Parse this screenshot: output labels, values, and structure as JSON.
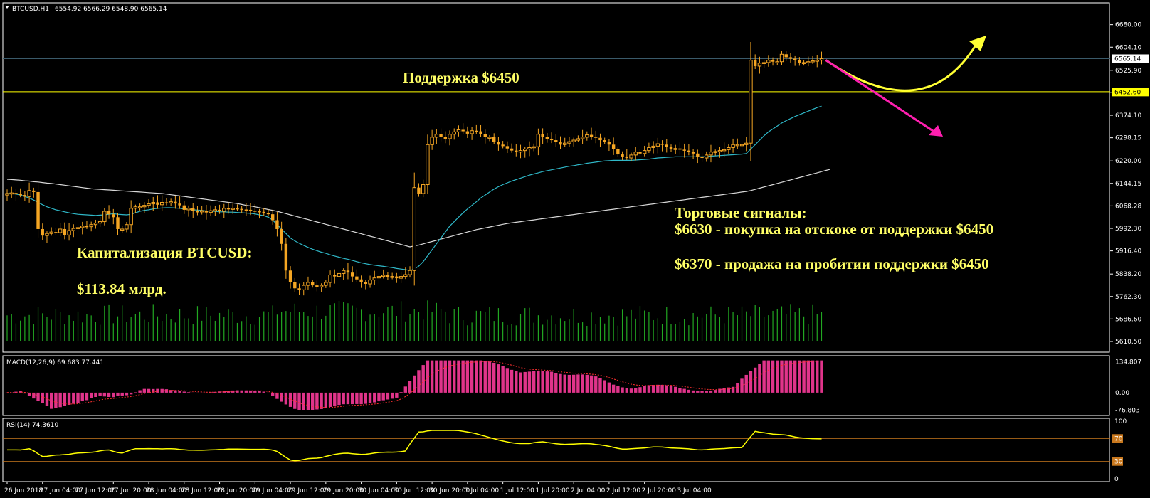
{
  "header": {
    "symbol": "BTCUSD,H1",
    "ohlc": "6554.92 6566.29 6548.90 6565.14",
    "macd_label": "MACD(12,26,9) 69.683 77.441",
    "rsi_label": "RSI(14) 74.3610"
  },
  "annotations": {
    "support": "Поддержка $6450",
    "cap_title": "Капитализация BTCUSD:",
    "cap_value": "$113.84 млрд.",
    "signals_title": "Торговые сигналы:",
    "signal_buy": "$6630 - покупка на отскоке от поддержки $6450",
    "signal_sell": "$6370 - продажа на пробитии поддержки $6450"
  },
  "colors": {
    "background": "#000000",
    "candle": "#f5a623",
    "support_line": "#ffff00",
    "ma_fast": "#2fb8c8",
    "ma_slow": "#d8d8d8",
    "volume": "#22a822",
    "macd_hist": "#e0348a",
    "macd_signal": "#ff3030",
    "rsi_line": "#ffff00",
    "rsi_levels": "#c8781e",
    "arrow_up": "#ffff33",
    "arrow_down": "#ff1fb0",
    "current_price_line": "#3a5a6a"
  },
  "chart_data": {
    "type": "candlestick",
    "instrument": "BTCUSD",
    "timeframe": "H1",
    "price_axis": {
      "ylim": [
        5610.5,
        6720
      ],
      "ticks": [
        "6680.00",
        "6604.10",
        "6525.90",
        "6451.55",
        "6374.10",
        "6298.15",
        "6220.00",
        "6144.15",
        "6068.28",
        "5992.30",
        "5916.40",
        "5838.20",
        "5762.30",
        "5686.60",
        "5610.50"
      ],
      "current_price": 6565.14,
      "current_price_tag": "6565.14",
      "support_level": 6452.6,
      "support_tag": "6452.60"
    },
    "x_axis": {
      "ticks": [
        "26 Jun 2018",
        "27 Jun 04:00",
        "27 Jun 12:00",
        "27 Jun 20:00",
        "28 Jun 04:00",
        "28 Jun 12:00",
        "28 Jun 20:00",
        "29 Jun 04:00",
        "29 Jun 12:00",
        "29 Jun 20:00",
        "30 Jun 04:00",
        "30 Jun 12:00",
        "30 Jun 20:00",
        "1 Jul 04:00",
        "1 Jul 12:00",
        "1 Jul 20:00",
        "2 Jul 04:00",
        "2 Jul 12:00",
        "2 Jul 20:00",
        "3 Jul 04:00"
      ],
      "bars_per_tick": 8
    },
    "candles_close": [
      6110,
      6112,
      6108,
      6105,
      6100,
      6120,
      6115,
      5990,
      5968,
      5975,
      5980,
      5978,
      5990,
      5970,
      5985,
      5992,
      5995,
      6000,
      5998,
      6005,
      6010,
      6015,
      6050,
      6040,
      6030,
      5990,
      5990,
      6005,
      6060,
      6065,
      6065,
      6070,
      6075,
      6080,
      6072,
      6080,
      6078,
      6082,
      6076,
      6070,
      6055,
      6060,
      6050,
      6048,
      6052,
      6046,
      6052,
      6055,
      6050,
      6060,
      6058,
      6060,
      6058,
      6056,
      6055,
      6052,
      6050,
      6048,
      6045,
      6040,
      6020,
      5990,
      5940,
      5850,
      5810,
      5790,
      5785,
      5800,
      5810,
      5800,
      5795,
      5800,
      5810,
      5835,
      5830,
      5840,
      5850,
      5843,
      5830,
      5820,
      5810,
      5805,
      5818,
      5825,
      5830,
      5834,
      5828,
      5830,
      5824,
      5830,
      5836,
      5850,
      6130,
      6110,
      6140,
      6275,
      6300,
      6310,
      6300,
      6295,
      6310,
      6318,
      6325,
      6320,
      6312,
      6322,
      6320,
      6310,
      6300,
      6300,
      6285,
      6275,
      6270,
      6262,
      6255,
      6250,
      6255,
      6260,
      6265,
      6268,
      6310,
      6300,
      6295,
      6290,
      6285,
      6275,
      6280,
      6285,
      6290,
      6295,
      6300,
      6308,
      6302,
      6298,
      6290,
      6285,
      6275,
      6260,
      6242,
      6235,
      6230,
      6240,
      6250,
      6245,
      6255,
      6265,
      6270,
      6278,
      6275,
      6268,
      6260,
      6262,
      6258,
      6255,
      6250,
      6245,
      6235,
      6230,
      6240,
      6250,
      6252,
      6255,
      6258,
      6265,
      6275,
      6275,
      6275,
      6280,
      6560,
      6540,
      6550,
      6552,
      6560,
      6555,
      6555,
      6580,
      6570,
      6565,
      6560,
      6550,
      6552,
      6555,
      6558,
      6560,
      6565
    ],
    "ma_fast": [
      6110,
      6110,
      6108,
      6105,
      6100,
      6095,
      6088,
      6080,
      6072,
      6065,
      6060,
      6055,
      6052,
      6048,
      6045,
      6042,
      6040,
      6039,
      6038,
      6037,
      6036,
      6037,
      6038,
      6040,
      6042,
      6040,
      6039,
      6038,
      6040,
      6045,
      6050,
      6053,
      6055,
      6058,
      6060,
      6061,
      6062,
      6062,
      6061,
      6060,
      6058,
      6057,
      6055,
      6054,
      6053,
      6051,
      6050,
      6050,
      6048,
      6048,
      6047,
      6047,
      6046,
      6045,
      6044,
      6043,
      6041,
      6038,
      6035,
      6030,
      6020,
      6005,
      5990,
      5975,
      5960,
      5950,
      5942,
      5935,
      5928,
      5922,
      5917,
      5912,
      5908,
      5903,
      5899,
      5895,
      5891,
      5888,
      5884,
      5880,
      5876,
      5873,
      5870,
      5868,
      5866,
      5864,
      5862,
      5860,
      5857,
      5855,
      5853,
      5850,
      5855,
      5865,
      5880,
      5900,
      5920,
      5940,
      5960,
      5980,
      6000,
      6015,
      6030,
      6045,
      6058,
      6070,
      6082,
      6095,
      6105,
      6115,
      6125,
      6133,
      6140,
      6146,
      6152,
      6157,
      6162,
      6167,
      6172,
      6176,
      6180,
      6184,
      6187,
      6190,
      6193,
      6196,
      6199,
      6202,
      6204,
      6207,
      6209,
      6212,
      6214,
      6216,
      6218,
      6220,
      6221,
      6222,
      6222,
      6222,
      6222,
      6222,
      6223,
      6224,
      6225,
      6226,
      6228,
      6230,
      6231,
      6232,
      6233,
      6234,
      6234,
      6234,
      6234,
      6234,
      6234,
      6234,
      6235,
      6236,
      6237,
      6238,
      6239,
      6240,
      6241,
      6242,
      6243,
      6245,
      6260,
      6275,
      6290,
      6305,
      6318,
      6328,
      6338,
      6348,
      6356,
      6363,
      6370,
      6376,
      6382,
      6388,
      6394,
      6400,
      6405
    ],
    "ma_slow": [
      6158,
      6157,
      6156,
      6155,
      6153,
      6152,
      6150,
      6149,
      6147,
      6145,
      6144,
      6142,
      6140,
      6138,
      6136,
      6134,
      6132,
      6130,
      6128,
      6126,
      6125,
      6124,
      6123,
      6122,
      6121,
      6120,
      6119,
      6118,
      6117,
      6116,
      6115,
      6114,
      6113,
      6112,
      6111,
      6110,
      6108,
      6106,
      6104,
      6102,
      6100,
      6098,
      6096,
      6094,
      6092,
      6090,
      6088,
      6086,
      6084,
      6082,
      6080,
      6078,
      6076,
      6073,
      6070,
      6068,
      6065,
      6062,
      6059,
      6056,
      6053,
      6050,
      6046,
      6042,
      6038,
      6034,
      6030,
      6026,
      6022,
      6018,
      6014,
      6010,
      6006,
      6002,
      5998,
      5994,
      5990,
      5986,
      5982,
      5978,
      5974,
      5970,
      5966,
      5962,
      5958,
      5954,
      5950,
      5946,
      5942,
      5938,
      5934,
      5930,
      5933,
      5936,
      5940,
      5944,
      5948,
      5952,
      5956,
      5960,
      5964,
      5968,
      5972,
      5976,
      5980,
      5984,
      5988,
      5991,
      5994,
      5997,
      6000,
      6003,
      6006,
      6009,
      6011,
      6013,
      6015,
      6017,
      6019,
      6021,
      6023,
      6025,
      6027,
      6029,
      6031,
      6033,
      6035,
      6037,
      6039,
      6041,
      6043,
      6045,
      6047,
      6049,
      6051,
      6053,
      6055,
      6057,
      6059,
      6061,
      6063,
      6065,
      6067,
      6069,
      6071,
      6073,
      6075,
      6077,
      6079,
      6081,
      6083,
      6085,
      6087,
      6089,
      6091,
      6093,
      6095,
      6097,
      6099,
      6101,
      6103,
      6105,
      6107,
      6109,
      6111,
      6113,
      6115,
      6117,
      6120,
      6124,
      6128,
      6132,
      6136,
      6140,
      6144,
      6148,
      6152,
      6156,
      6160,
      6164,
      6168,
      6172,
      6176,
      6180,
      6184,
      6188,
      6192
    ],
    "macd": {
      "ylim": [
        -90,
        145
      ],
      "ticks": [
        "134.807",
        "0.00",
        "-76.803"
      ],
      "note_signal_and_hist_shape": "histogram rises to about 140 after 29 Jun 20:00 breakout, dips to about -75 near 29 Jun 04:00"
    },
    "rsi": {
      "ylim": [
        0,
        100
      ],
      "ticks": [
        "100",
        "70",
        "30",
        "0"
      ],
      "levels": [
        70,
        30
      ]
    },
    "forecast_arrows": {
      "up": "curve down to support then up toward 6680",
      "down": "magenta arrow from current price toward about 6370"
    }
  }
}
